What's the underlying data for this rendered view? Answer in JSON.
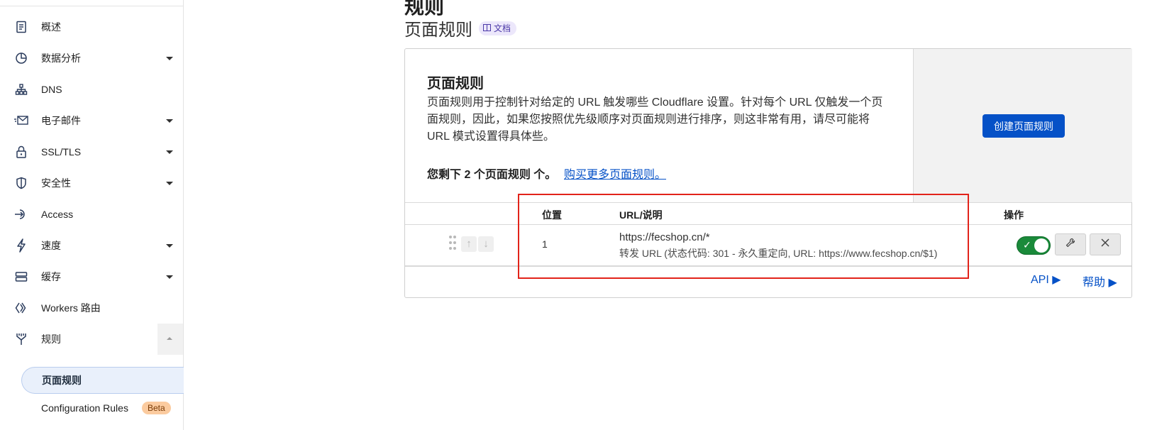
{
  "sidebar": {
    "items": [
      {
        "label": "概述",
        "icon": "document-icon",
        "has_caret": false
      },
      {
        "label": "数据分析",
        "icon": "analytics-icon",
        "has_caret": true
      },
      {
        "label": "DNS",
        "icon": "dns-icon",
        "has_caret": false
      },
      {
        "label": "电子邮件",
        "icon": "email-icon",
        "has_caret": true
      },
      {
        "label": "SSL/TLS",
        "icon": "lock-icon",
        "has_caret": true
      },
      {
        "label": "安全性",
        "icon": "shield-icon",
        "has_caret": true
      },
      {
        "label": "Access",
        "icon": "access-icon",
        "has_caret": false
      },
      {
        "label": "速度",
        "icon": "lightning-icon",
        "has_caret": true
      },
      {
        "label": "缓存",
        "icon": "cache-icon",
        "has_caret": true
      },
      {
        "label": "Workers 路由",
        "icon": "workers-icon",
        "has_caret": false
      },
      {
        "label": "规则",
        "icon": "rules-icon",
        "has_caret": "up"
      }
    ],
    "sub_items": [
      {
        "label": "页面规则",
        "active": true
      },
      {
        "label": "Configuration Rules",
        "badge": "Beta"
      }
    ]
  },
  "header": {
    "title": "规则",
    "subtitle": "页面规则",
    "docs_badge": "文档"
  },
  "card": {
    "title": "页面规则",
    "description": "页面规则用于控制针对给定的 URL 触发哪些 Cloudflare 设置。针对每个 URL 仅触发一个页面规则，因此，如果您按照优先级顺序对页面规则进行排序，则这非常有用，请尽可能将 URL 模式设置得具体些。",
    "remaining_prefix": "您剩下",
    "remaining_count": "2",
    "remaining_suffix": "个页面规则 个。",
    "buy_link": "购买更多页面规则。",
    "create_button": "创建页面规则"
  },
  "table": {
    "columns": {
      "position": "位置",
      "url": "URL/说明",
      "actions": "操作"
    },
    "rows": [
      {
        "position": "1",
        "url": "https://fecshop.cn/*",
        "description": "转发 URL (状态代码: 301 - 永久重定向, URL: https://www.fecshop.cn/$1)",
        "enabled": true
      }
    ]
  },
  "footer": {
    "api_link": "API ▶",
    "help_link": "帮助 ▶"
  },
  "colors": {
    "primary": "#0551c7",
    "toggle_on": "#1a8a3a",
    "highlight": "#e2231a",
    "beta_badge": "#fbcb9f"
  }
}
